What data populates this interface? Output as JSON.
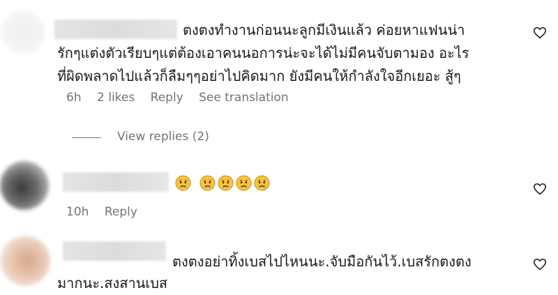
{
  "comments": [
    {
      "text_lines": [
        "ตงตงทำงานก่อนนะลูกมีเงินแล้ว ค่อยหาแฟนน่า",
        "รักๆแต่งตัวเรียบๆแต่ต้องเอาคนนอการน่ะจะได้ไม่มีคนจับตามอง อะไร",
        "ที่ผิดพลาดไปแล้วก็ลืมๆๆอย่าไปคิดมาก ยังมีคนให้กำลังใจอีกเยอะ สู้ๆ"
      ],
      "time": "6h",
      "likes": "2 likes",
      "reply": "Reply",
      "translation": "See translation",
      "view_replies": "View replies (2)"
    },
    {
      "emoji_count": 5,
      "time": "10h",
      "reply": "Reply"
    },
    {
      "text_lines": [
        "ตงตงอย่าทิ้งเบสไปไหนนะ.จับมือกันไว้.เบสรักตงตง",
        "มากนะ.สงสานเบส"
      ]
    }
  ],
  "icons": {
    "heart": "heart-outline-icon",
    "emoji": "crying-face-icon"
  }
}
